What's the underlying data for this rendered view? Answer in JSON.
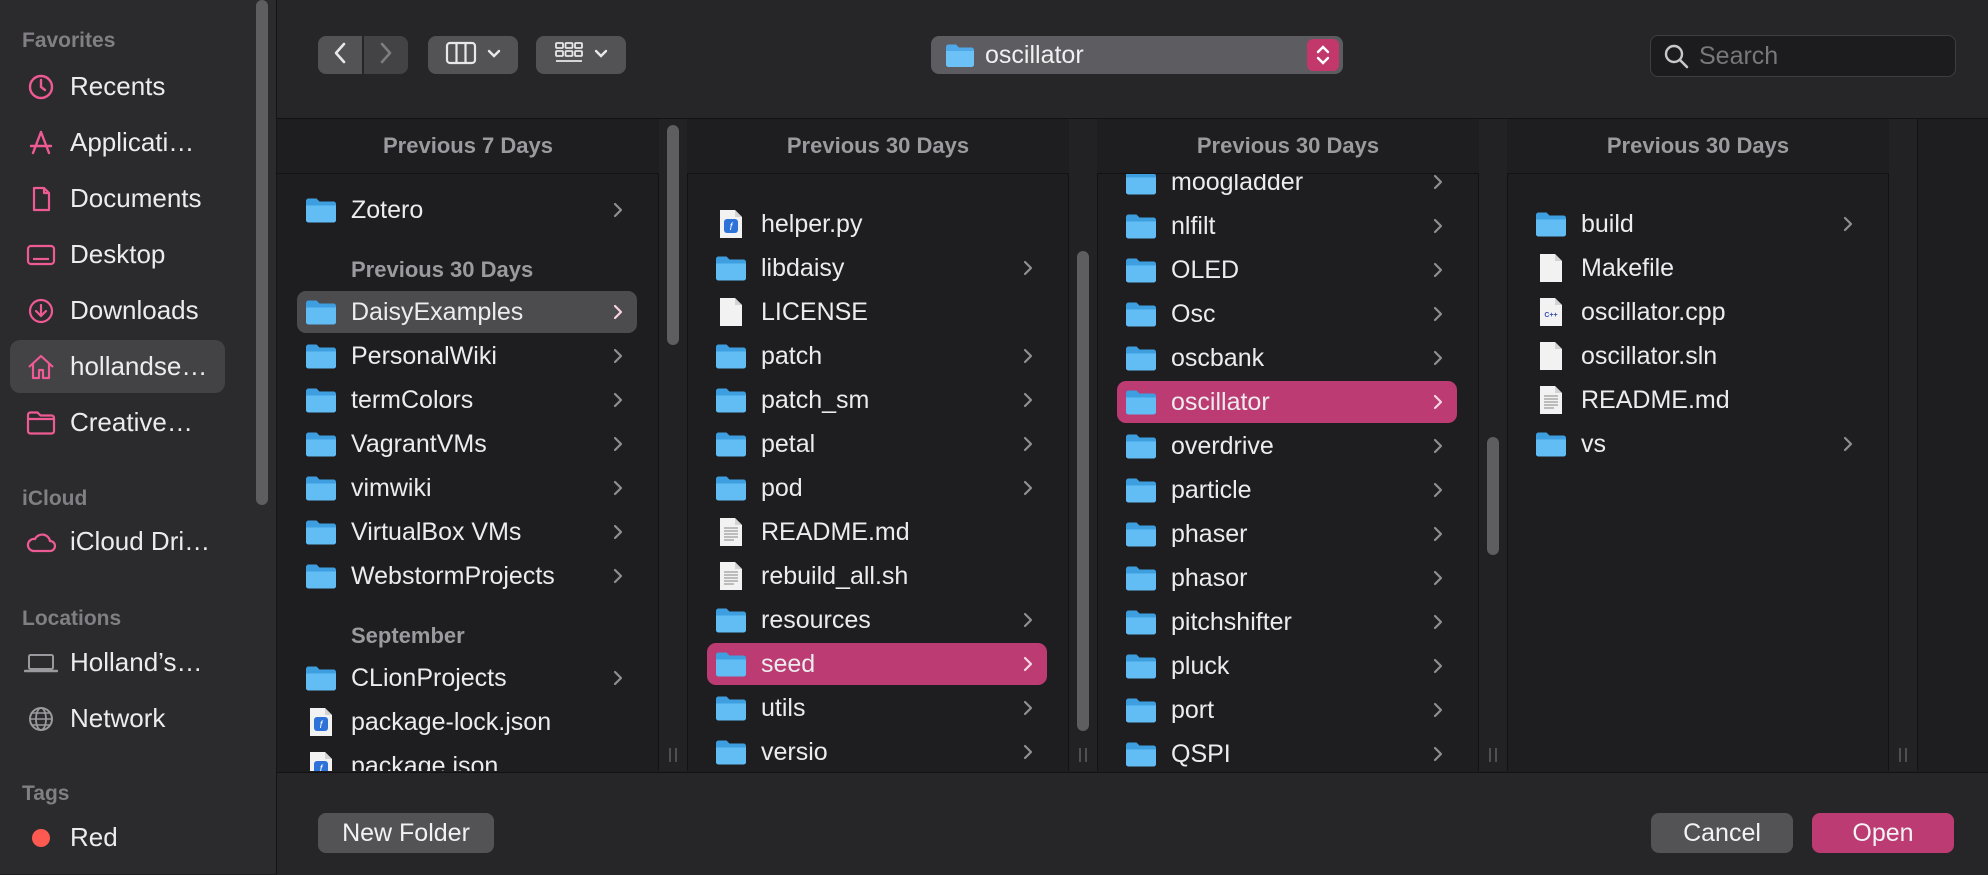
{
  "sidebar": {
    "sections": {
      "favorites": "Favorites",
      "icloud": "iCloud",
      "locations": "Locations",
      "tags": "Tags"
    },
    "favorites": [
      {
        "label": "Recents",
        "icon": "clock-icon"
      },
      {
        "label": "Applicati…",
        "icon": "applications-icon"
      },
      {
        "label": "Documents",
        "icon": "document-icon"
      },
      {
        "label": "Desktop",
        "icon": "desktop-icon"
      },
      {
        "label": "Downloads",
        "icon": "downloads-icon"
      },
      {
        "label": "hollandse…",
        "icon": "home-icon"
      },
      {
        "label": "Creative…",
        "icon": "folder-outline-icon"
      }
    ],
    "icloud": [
      {
        "label": "iCloud Dri…",
        "icon": "cloud-icon"
      }
    ],
    "locations": [
      {
        "label": "Holland’s…",
        "icon": "laptop-icon"
      },
      {
        "label": "Network",
        "icon": "globe-icon"
      }
    ],
    "tags": [
      {
        "label": "Red",
        "color": "#ff5a52"
      }
    ]
  },
  "toolbar": {
    "back_icon": "chevron-left-icon",
    "forward_icon": "chevron-right-icon",
    "view_icon": "columns-view-icon",
    "group_icon": "grid-group-icon",
    "location": "oscillator",
    "search_placeholder": "Search"
  },
  "columns": [
    {
      "header": "Previous 7 Days",
      "groups": [
        {
          "title": null,
          "rows": [
            {
              "label": "Zotero",
              "type": "folder",
              "chevron": true
            }
          ]
        },
        {
          "title": "Previous 30 Days",
          "rows": [
            {
              "label": "DaisyExamples",
              "type": "folder",
              "chevron": true,
              "selected": "gray"
            },
            {
              "label": "PersonalWiki",
              "type": "folder",
              "chevron": true
            },
            {
              "label": "termColors",
              "type": "folder",
              "chevron": true
            },
            {
              "label": "VagrantVMs",
              "type": "folder",
              "chevron": true
            },
            {
              "label": "vimwiki",
              "type": "folder",
              "chevron": true
            },
            {
              "label": "VirtualBox VMs",
              "type": "folder",
              "chevron": true
            },
            {
              "label": "WebstormProjects",
              "type": "folder",
              "chevron": true
            }
          ]
        },
        {
          "title": "September",
          "rows": [
            {
              "label": "CLionProjects",
              "type": "folder",
              "chevron": true
            },
            {
              "label": "package-lock.json",
              "type": "json"
            },
            {
              "label": "package.json",
              "type": "json"
            }
          ]
        }
      ]
    },
    {
      "header": "Previous 30 Days",
      "rows": [
        {
          "label": "helper.py",
          "type": "python"
        },
        {
          "label": "libdaisy",
          "type": "folder",
          "chevron": true
        },
        {
          "label": "LICENSE",
          "type": "file"
        },
        {
          "label": "patch",
          "type": "folder",
          "chevron": true
        },
        {
          "label": "patch_sm",
          "type": "folder",
          "chevron": true
        },
        {
          "label": "petal",
          "type": "folder",
          "chevron": true
        },
        {
          "label": "pod",
          "type": "folder",
          "chevron": true
        },
        {
          "label": "README.md",
          "type": "text"
        },
        {
          "label": "rebuild_all.sh",
          "type": "text"
        },
        {
          "label": "resources",
          "type": "folder",
          "chevron": true
        },
        {
          "label": "seed",
          "type": "folder",
          "chevron": true,
          "selected": "pink"
        },
        {
          "label": "utils",
          "type": "folder",
          "chevron": true
        },
        {
          "label": "versio",
          "type": "folder",
          "chevron": true
        }
      ]
    },
    {
      "header": "Previous 30 Days",
      "rows": [
        {
          "label": "moogladder",
          "type": "folder",
          "chevron": true
        },
        {
          "label": "nlfilt",
          "type": "folder",
          "chevron": true
        },
        {
          "label": "OLED",
          "type": "folder",
          "chevron": true
        },
        {
          "label": "Osc",
          "type": "folder",
          "chevron": true
        },
        {
          "label": "oscbank",
          "type": "folder",
          "chevron": true
        },
        {
          "label": "oscillator",
          "type": "folder",
          "chevron": true,
          "selected": "pink"
        },
        {
          "label": "overdrive",
          "type": "folder",
          "chevron": true
        },
        {
          "label": "particle",
          "type": "folder",
          "chevron": true
        },
        {
          "label": "phaser",
          "type": "folder",
          "chevron": true
        },
        {
          "label": "phasor",
          "type": "folder",
          "chevron": true
        },
        {
          "label": "pitchshifter",
          "type": "folder",
          "chevron": true
        },
        {
          "label": "pluck",
          "type": "folder",
          "chevron": true
        },
        {
          "label": "port",
          "type": "folder",
          "chevron": true
        },
        {
          "label": "QSPI",
          "type": "folder",
          "chevron": true
        }
      ]
    },
    {
      "header": "Previous 30 Days",
      "rows": [
        {
          "label": "build",
          "type": "folder",
          "chevron": true
        },
        {
          "label": "Makefile",
          "type": "file"
        },
        {
          "label": "oscillator.cpp",
          "type": "cpp"
        },
        {
          "label": "oscillator.sln",
          "type": "file"
        },
        {
          "label": "README.md",
          "type": "text"
        },
        {
          "label": "vs",
          "type": "folder",
          "chevron": true
        }
      ]
    }
  ],
  "footer": {
    "new_folder": "New Folder",
    "cancel": "Cancel",
    "open": "Open"
  },
  "colors": {
    "accent": "#bb3b72",
    "folder": "#5ab4f0",
    "sidebar_icon": "#ee5a93"
  }
}
